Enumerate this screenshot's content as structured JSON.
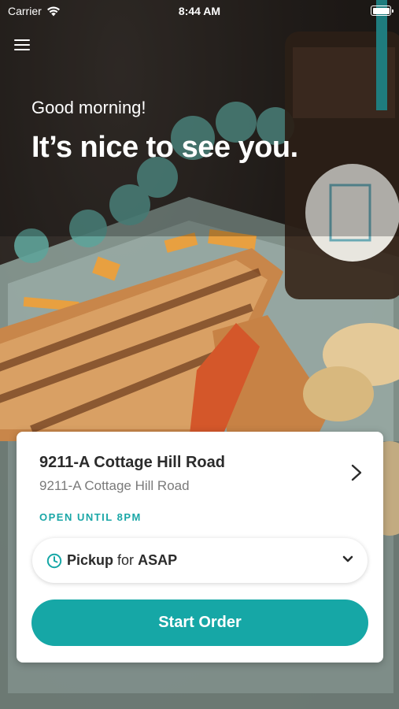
{
  "status_bar": {
    "carrier": "Carrier",
    "time": "8:44 AM"
  },
  "header": {
    "menu_icon": "hamburger-menu-icon",
    "greeting": "Good morning!",
    "headline": "It’s nice to see you."
  },
  "store": {
    "name": "9211-A Cottage Hill Road",
    "address": "9211-A Cottage Hill Road",
    "hours": "OPEN UNTIL 8PM"
  },
  "order_mode": {
    "mode": "Pickup",
    "connector": "for",
    "when": "ASAP"
  },
  "actions": {
    "start_order": "Start Order"
  },
  "colors": {
    "accent": "#16a7a6",
    "text_dark": "#2b2b2b",
    "text_muted": "#7a7a7a"
  }
}
